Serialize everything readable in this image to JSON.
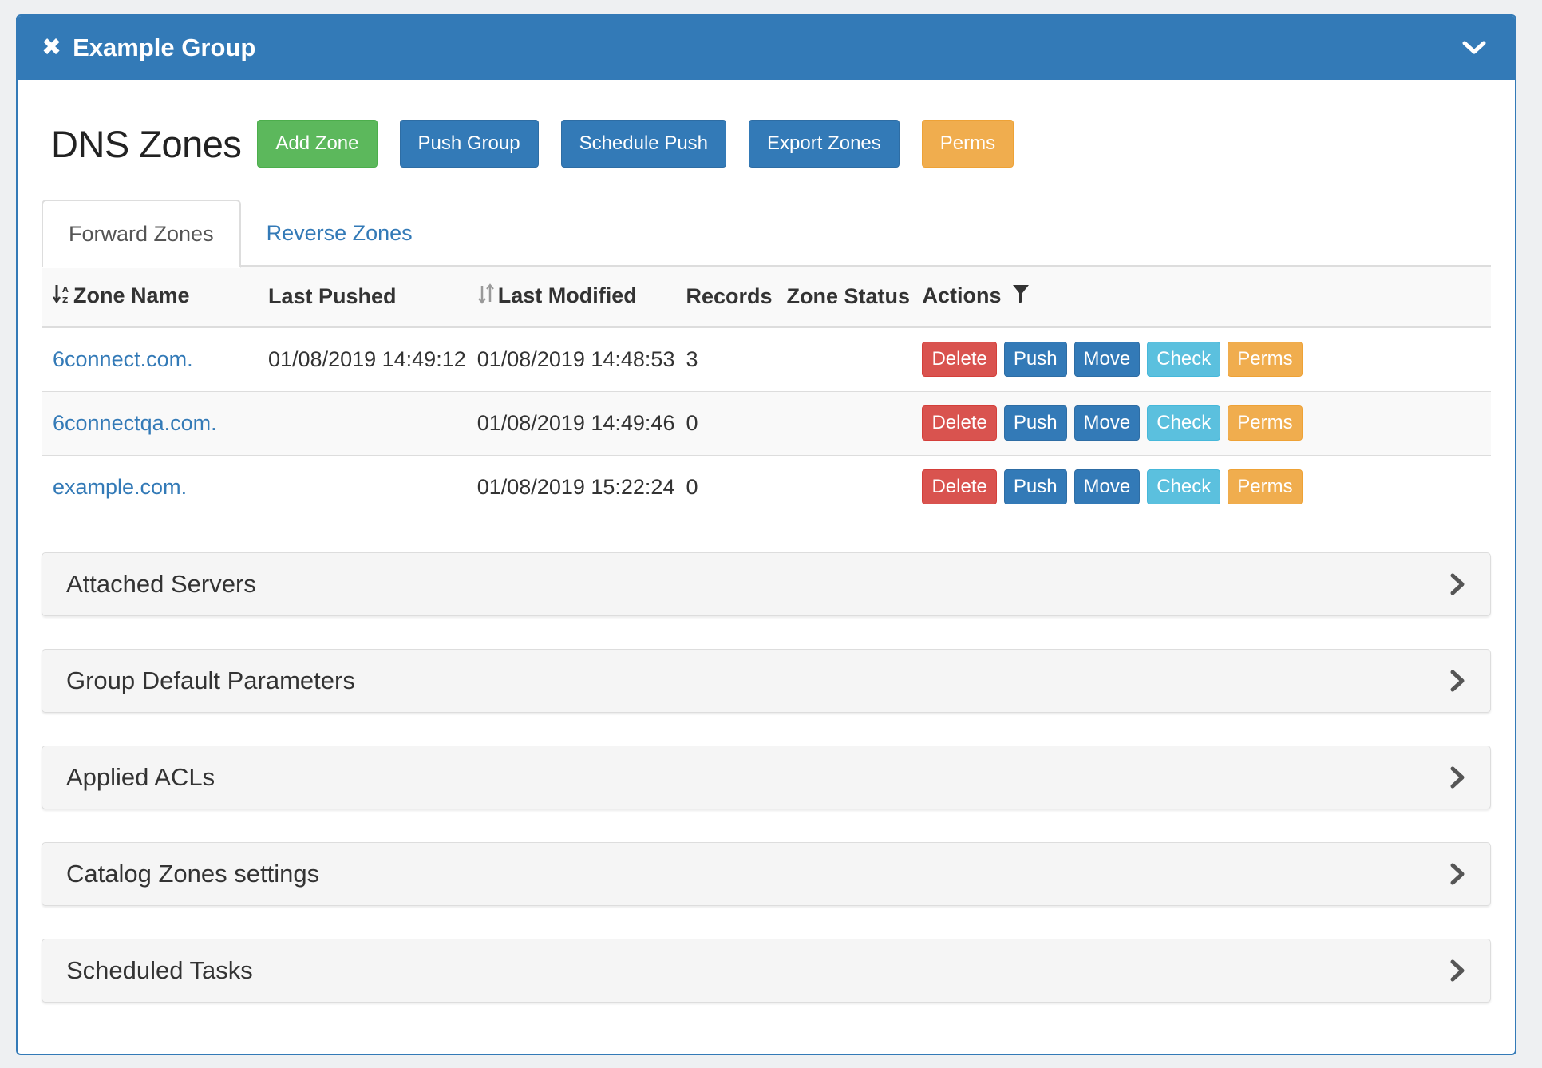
{
  "header": {
    "title": "Example Group",
    "close_icon": "✖"
  },
  "main": {
    "title": "DNS Zones",
    "buttons": {
      "add_zone": "Add Zone",
      "push_group": "Push Group",
      "schedule_push": "Schedule Push",
      "export_zones": "Export Zones",
      "perms": "Perms"
    },
    "tabs": [
      {
        "label": "Forward Zones",
        "active": true
      },
      {
        "label": "Reverse Zones",
        "active": false
      }
    ]
  },
  "table": {
    "columns": {
      "zone_name": "Zone Name",
      "last_pushed": "Last Pushed",
      "last_modified": "Last Modified",
      "records": "Records",
      "zone_status": "Zone Status",
      "actions": "Actions"
    },
    "action_labels": {
      "delete": "Delete",
      "push": "Push",
      "move": "Move",
      "check": "Check",
      "perms": "Perms"
    },
    "rows": [
      {
        "zone_name": "6connect.com.",
        "last_pushed": "01/08/2019 14:49:12",
        "last_modified": "01/08/2019 14:48:53",
        "records": "3",
        "zone_status": ""
      },
      {
        "zone_name": "6connectqa.com.",
        "last_pushed": "",
        "last_modified": "01/08/2019 14:49:46",
        "records": "0",
        "zone_status": ""
      },
      {
        "zone_name": "example.com.",
        "last_pushed": "",
        "last_modified": "01/08/2019 15:22:24",
        "records": "0",
        "zone_status": ""
      }
    ]
  },
  "sections": [
    {
      "title": "Attached Servers"
    },
    {
      "title": "Group Default Parameters"
    },
    {
      "title": "Applied ACLs"
    },
    {
      "title": "Catalog Zones settings"
    },
    {
      "title": "Scheduled Tasks"
    }
  ],
  "colors": {
    "primary": "#337ab7",
    "success": "#5cb85c",
    "warning": "#f0ad4e",
    "danger": "#d9534f",
    "info": "#5bc0de"
  }
}
